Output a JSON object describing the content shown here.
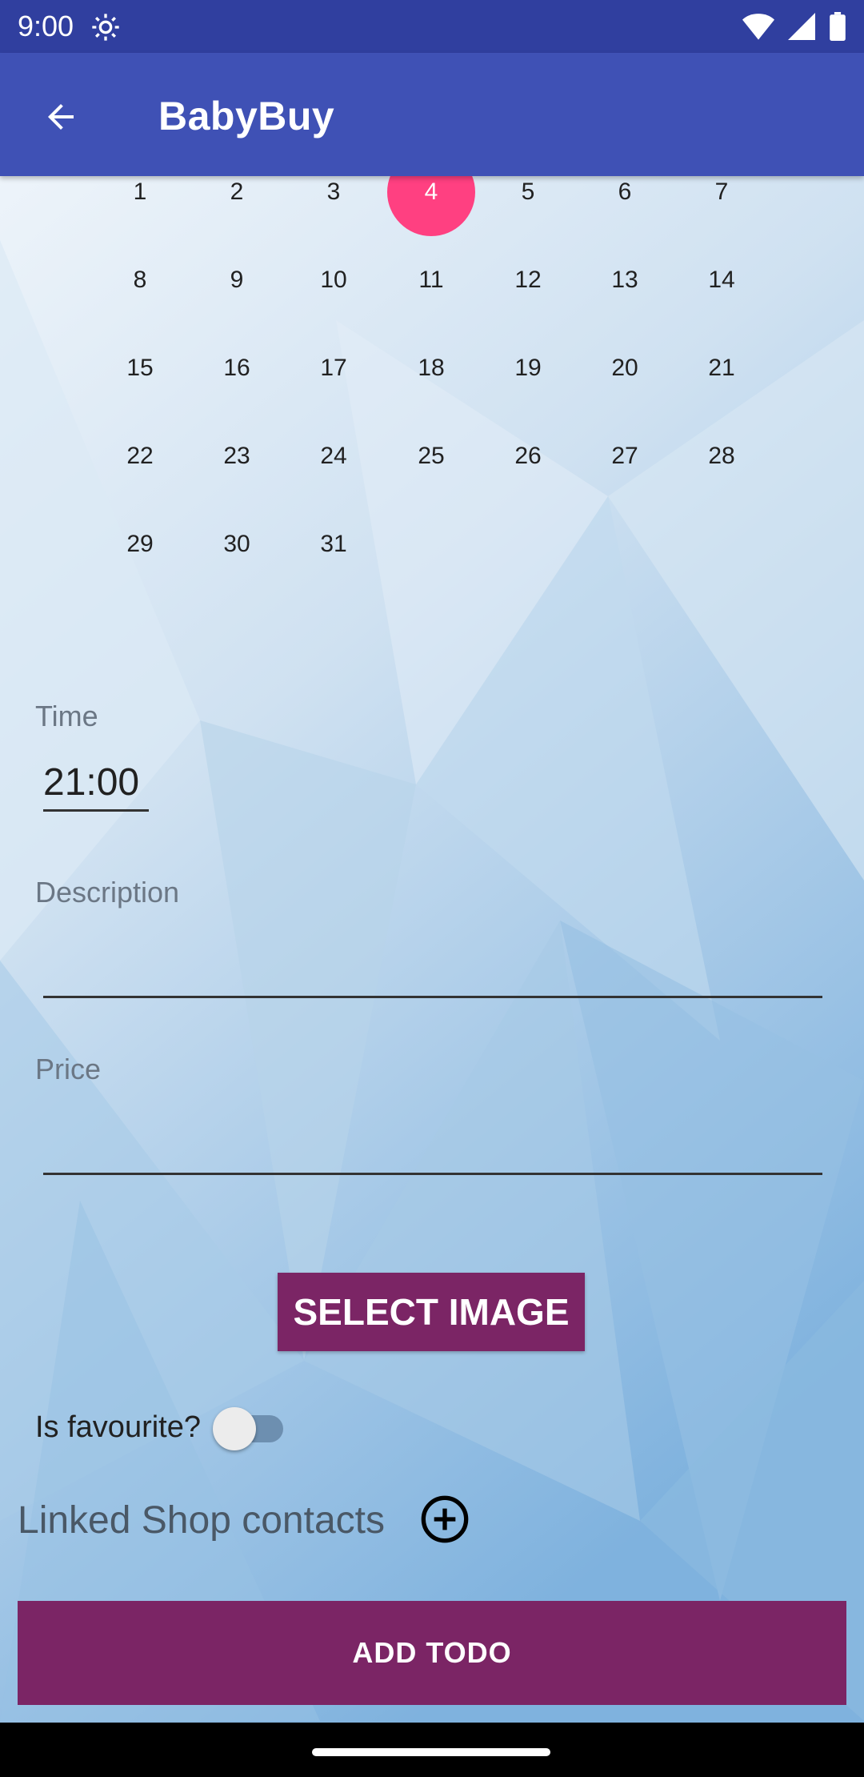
{
  "status_bar": {
    "time": "9:00"
  },
  "app_bar": {
    "title": "BabyBuy"
  },
  "calendar": {
    "selected_day": "4",
    "weeks": [
      [
        "1",
        "2",
        "3",
        "4",
        "5",
        "6",
        "7"
      ],
      [
        "8",
        "9",
        "10",
        "11",
        "12",
        "13",
        "14"
      ],
      [
        "15",
        "16",
        "17",
        "18",
        "19",
        "20",
        "21"
      ],
      [
        "22",
        "23",
        "24",
        "25",
        "26",
        "27",
        "28"
      ],
      [
        "29",
        "30",
        "31"
      ]
    ],
    "selected_color": "#ff4081"
  },
  "form": {
    "time_label": "Time",
    "time_value": "21:00",
    "description_label": "Description",
    "description_value": "",
    "price_label": "Price",
    "price_value": "",
    "select_image_label": "SELECT IMAGE",
    "favourite_label": "Is favourite?",
    "favourite_on": false,
    "linked_contacts_label": "Linked Shop contacts",
    "add_todo_label": "ADD TODO"
  },
  "colors": {
    "status_bar": "#303f9f",
    "app_bar": "#3f51b5",
    "button": "#7b2565"
  },
  "icons": {
    "back": "arrow-back-icon",
    "settings": "gear-icon",
    "wifi": "wifi-icon",
    "signal": "signal-icon",
    "battery": "battery-icon",
    "add_contact": "add-circle-icon"
  }
}
